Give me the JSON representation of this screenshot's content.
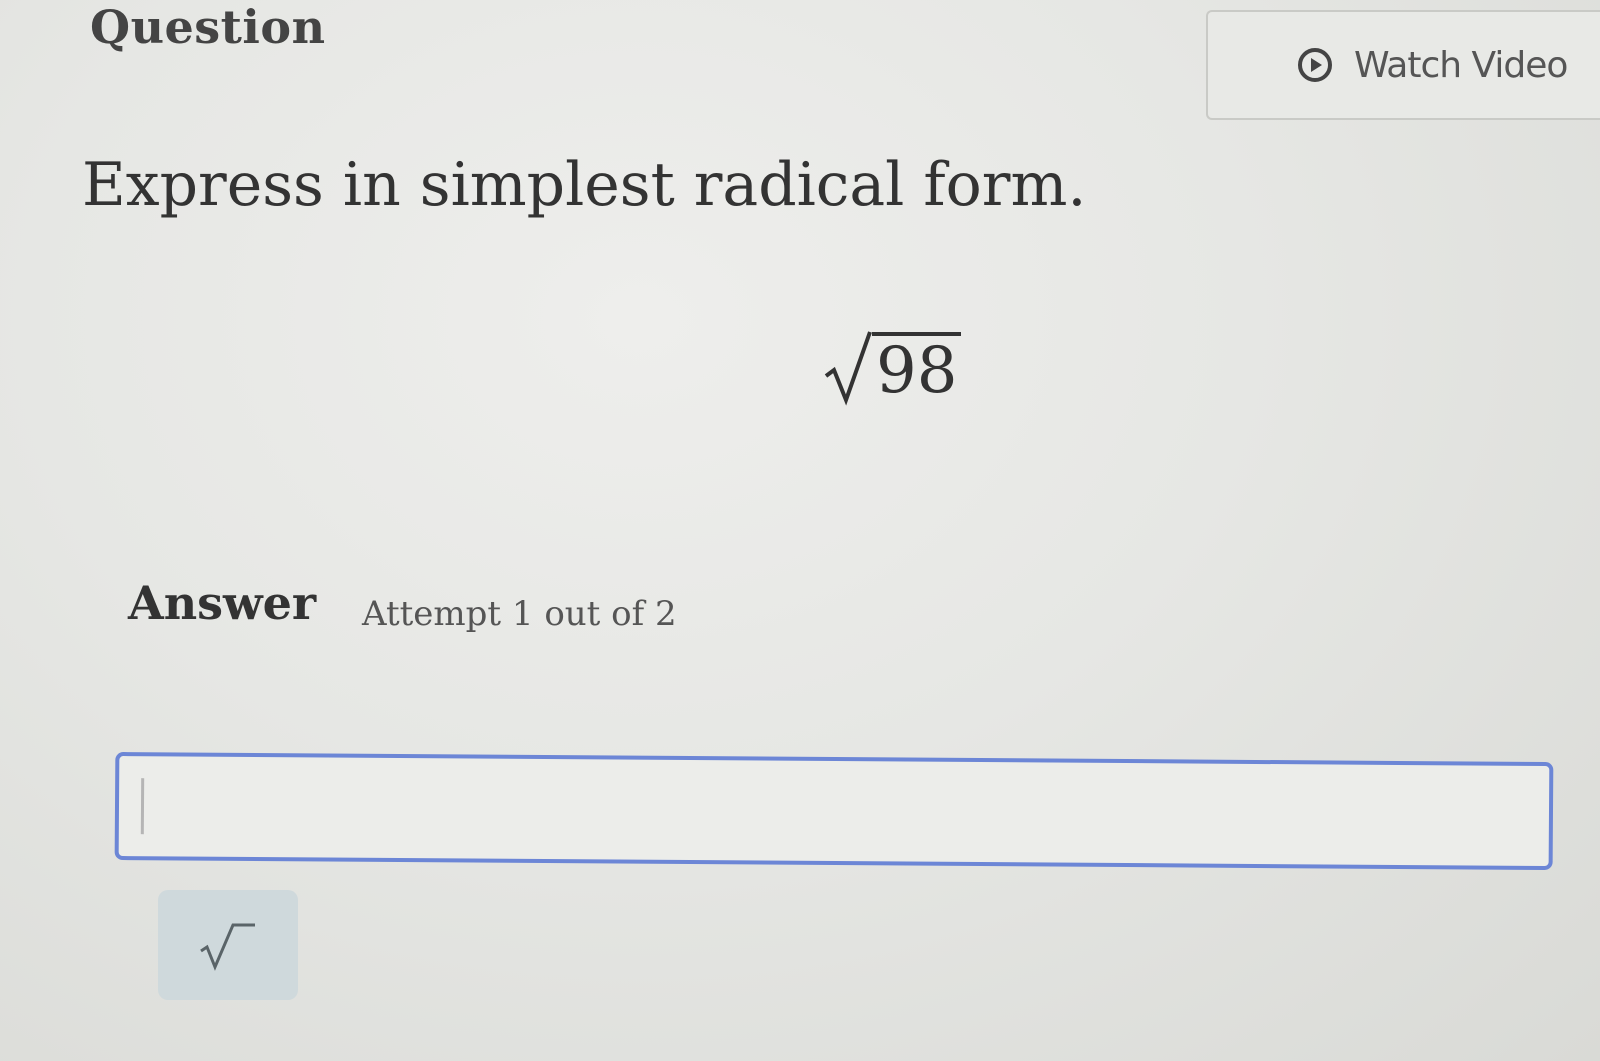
{
  "header": {
    "title": "Question",
    "watch_video_label": "Watch Video"
  },
  "question": {
    "prompt": "Express in simplest radical form.",
    "radicand": "98"
  },
  "answer": {
    "label": "Answer",
    "attempt_text": "Attempt 1 out of 2",
    "input_value": ""
  },
  "toolbar": {
    "buttons": [
      {
        "icon": "square-root-icon"
      }
    ]
  },
  "colors": {
    "input_border": "#6c86d6",
    "sqrt_button_bg": "#cfd9dc",
    "background": "#e6e7e4"
  }
}
